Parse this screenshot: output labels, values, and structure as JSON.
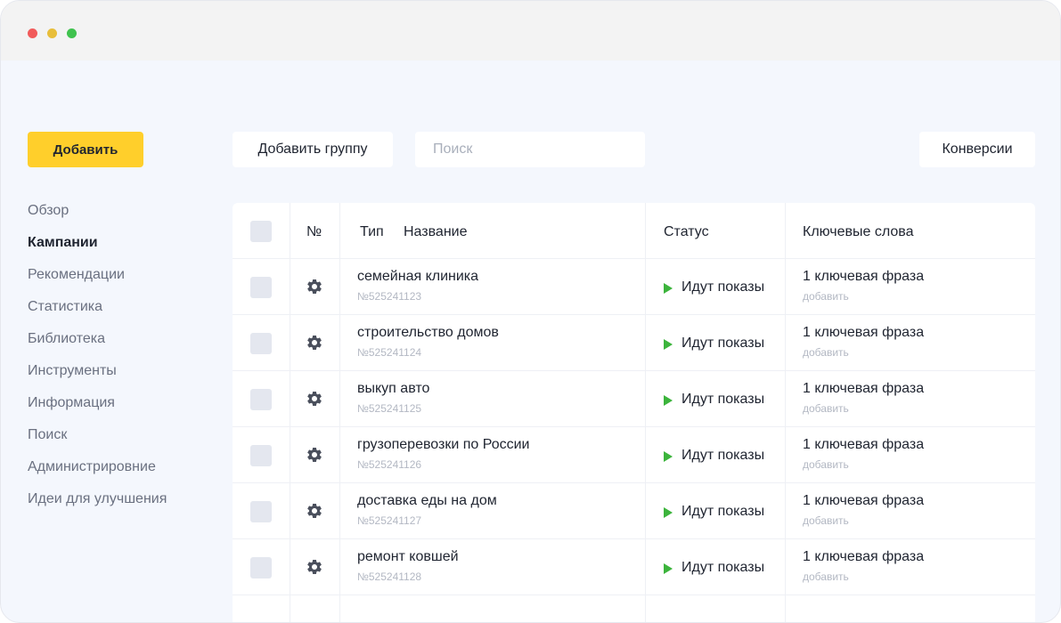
{
  "window": {},
  "sidebar": {
    "add_label": "Добавить",
    "items": [
      {
        "label": "Обзор",
        "active": false
      },
      {
        "label": "Кампании",
        "active": true
      },
      {
        "label": "Рекомендации",
        "active": false
      },
      {
        "label": "Статистика",
        "active": false
      },
      {
        "label": "Библиотека",
        "active": false
      },
      {
        "label": "Инструменты",
        "active": false
      },
      {
        "label": "Информация",
        "active": false
      },
      {
        "label": "Поиск",
        "active": false
      },
      {
        "label": "Администрировние",
        "active": false
      },
      {
        "label": "Идеи для улучшения",
        "active": false
      }
    ]
  },
  "toolbar": {
    "add_group_label": "Добавить группу",
    "search_placeholder": "Поиск",
    "conversions_label": "Конверсии"
  },
  "table": {
    "headers": {
      "number": "№",
      "type": "Тип",
      "name": "Название",
      "status": "Статус",
      "keywords": "Ключевые слова"
    },
    "rows": [
      {
        "name": "семейная клиника",
        "id": "№525241123",
        "status": "Идут показы",
        "keywords": "1 ключевая фраза",
        "keywords_action": "добавить"
      },
      {
        "name": "строительство домов",
        "id": "№525241124",
        "status": "Идут показы",
        "keywords": "1 ключевая фраза",
        "keywords_action": "добавить"
      },
      {
        "name": "выкуп авто",
        "id": "№525241125",
        "status": "Идут показы",
        "keywords": "1 ключевая фраза",
        "keywords_action": "добавить"
      },
      {
        "name": "грузоперевозки по России",
        "id": "№525241126",
        "status": "Идут показы",
        "keywords": "1 ключевая фраза",
        "keywords_action": "добавить"
      },
      {
        "name": "доставка еды на дом",
        "id": "№525241127",
        "status": "Идут показы",
        "keywords": "1 ключевая фраза",
        "keywords_action": "добавить"
      },
      {
        "name": "ремонт ковшей",
        "id": "№525241128",
        "status": "Идут показы",
        "keywords": "1 ключевая фраза",
        "keywords_action": "добавить"
      }
    ]
  },
  "colors": {
    "accent": "#ffcf2b",
    "status_running": "#3cb43c",
    "background": "#f4f7fd"
  },
  "icons": {
    "row_settings": "gear-icon",
    "status": "play-icon"
  }
}
